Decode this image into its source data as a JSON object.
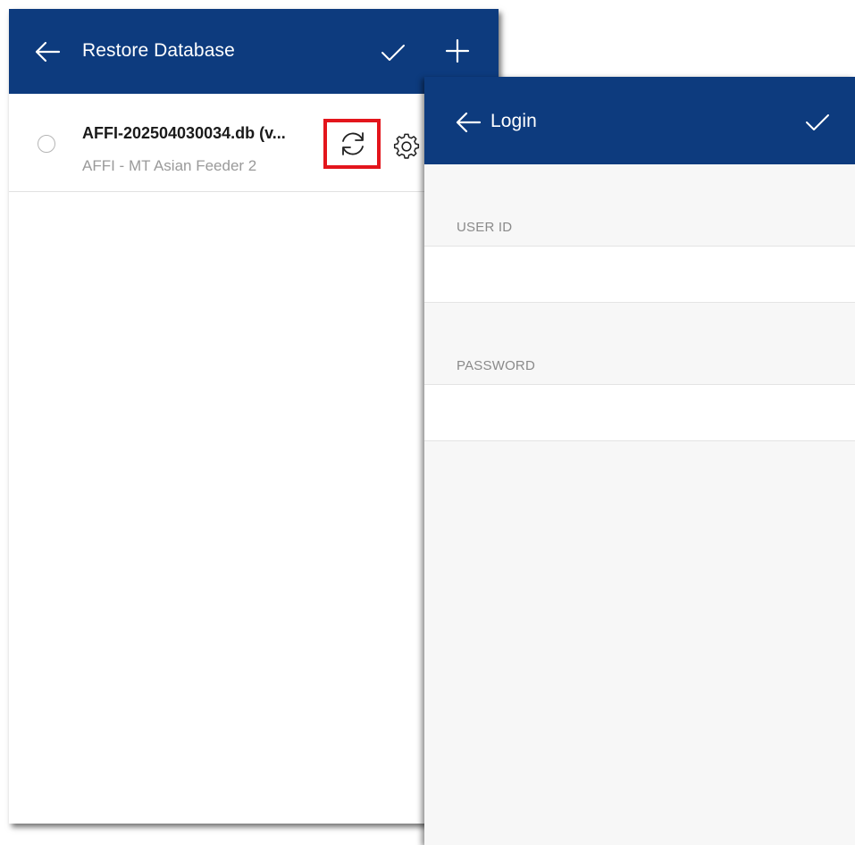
{
  "restore_screen": {
    "title": "Restore Database",
    "icons": {
      "back": "arrow-left-icon",
      "confirm": "check-icon",
      "add": "plus-icon"
    },
    "databases": [
      {
        "name": "AFFI-202504030034.db (v...",
        "vessel": "AFFI - MT Asian Feeder 2",
        "selected": false,
        "actions": [
          "sync-icon",
          "gear-icon"
        ]
      }
    ]
  },
  "login_screen": {
    "title": "Login",
    "icons": {
      "back": "arrow-left-icon",
      "confirm": "check-icon"
    },
    "fields": [
      {
        "label": "USER ID",
        "value": ""
      },
      {
        "label": "PASSWORD",
        "value": ""
      }
    ]
  },
  "colors": {
    "appbar": "#0d3b7e",
    "highlight": "#e3151c",
    "background": "#f7f7f7"
  }
}
